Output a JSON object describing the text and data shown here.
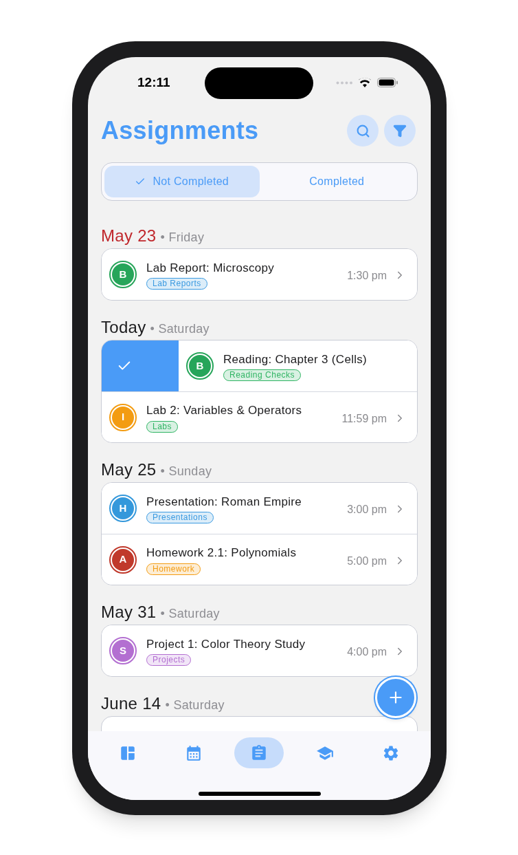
{
  "status_bar": {
    "time": "12:11"
  },
  "title": "Assignments",
  "tabs": [
    {
      "label": "Not Completed",
      "selected": true
    },
    {
      "label": "Completed",
      "selected": false
    }
  ],
  "sections": [
    {
      "date": "May 23",
      "weekday": "• Friday",
      "overdue": true,
      "items": [
        {
          "initial": "B",
          "color": "#27a55a",
          "title": "Lab Report: Microscopy",
          "tag": {
            "label": "Lab Reports",
            "color": "#3b9ae0"
          },
          "time": "1:30 pm",
          "swiped": false
        }
      ]
    },
    {
      "date": "Today",
      "weekday": "• Saturday",
      "overdue": false,
      "items": [
        {
          "initial": "B",
          "color": "#27a55a",
          "title": "Reading: Chapter 3 (Cells)",
          "tag": {
            "label": "Reading Checks",
            "color": "#2fb463"
          },
          "swiped": true
        },
        {
          "initial": "I",
          "color": "#f39c12",
          "title": "Lab 2: Variables & Operators",
          "tag": {
            "label": "Labs",
            "color": "#2fb463"
          },
          "time": "11:59 pm",
          "swiped": false
        }
      ]
    },
    {
      "date": "May 25",
      "weekday": "• Sunday",
      "overdue": false,
      "items": [
        {
          "initial": "H",
          "color": "#3498db",
          "title": "Presentation: Roman Empire",
          "tag": {
            "label": "Presentations",
            "color": "#3b9ae0"
          },
          "time": "3:00 pm",
          "swiped": false
        },
        {
          "initial": "A",
          "color": "#c0392b",
          "title": "Homework 2.1: Polynomials",
          "tag": {
            "label": "Homework",
            "color": "#f39c12"
          },
          "time": "5:00 pm",
          "swiped": false
        }
      ]
    },
    {
      "date": "May 31",
      "weekday": "• Saturday",
      "overdue": false,
      "items": [
        {
          "initial": "S",
          "color": "#b36fd1",
          "title": "Project 1: Color Theory Study",
          "tag": {
            "label": "Projects",
            "color": "#b36fd1"
          },
          "time": "4:00 pm",
          "swiped": false
        }
      ]
    },
    {
      "date": "June 14",
      "weekday": "• Saturday",
      "overdue": false
    }
  ],
  "nav": [
    {
      "selected": false
    },
    {
      "selected": false
    },
    {
      "selected": true
    },
    {
      "selected": false
    },
    {
      "selected": false
    }
  ]
}
